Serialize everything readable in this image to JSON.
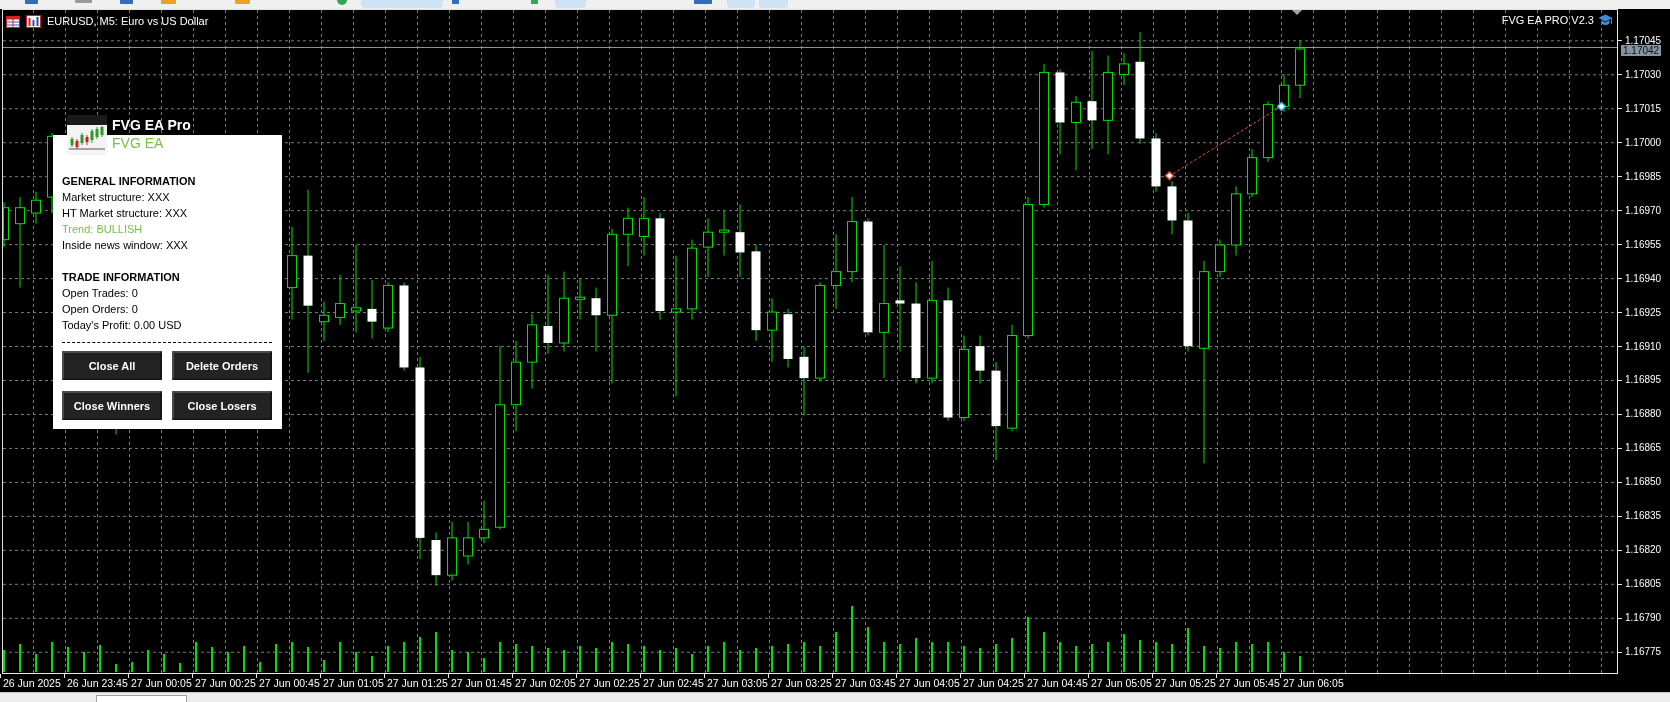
{
  "chart": {
    "title": "EURUSD, M5: Euro vs US Dollar",
    "indicator_label": "FVG EA PRO V2.3",
    "current_price": "1.17042",
    "price_axis": [
      "1.17045",
      "1.17030",
      "1.17015",
      "1.17000",
      "1.16985",
      "1.16970",
      "1.16955",
      "1.16940",
      "1.16925",
      "1.16910",
      "1.16895",
      "1.16880",
      "1.16865",
      "1.16850",
      "1.16835",
      "1.16820",
      "1.16805",
      "1.16790",
      "1.16775"
    ],
    "time_axis": [
      "26 Jun 2025",
      "26 Jun 23:45",
      "27 Jun 00:05",
      "27 Jun 00:25",
      "27 Jun 00:45",
      "27 Jun 01:05",
      "27 Jun 01:25",
      "27 Jun 01:45",
      "27 Jun 02:05",
      "27 Jun 02:25",
      "27 Jun 02:45",
      "27 Jun 03:05",
      "27 Jun 03:25",
      "27 Jun 03:45",
      "27 Jun 04:05",
      "27 Jun 04:25",
      "27 Jun 04:45",
      "27 Jun 05:05",
      "27 Jun 05:25",
      "27 Jun 05:45",
      "27 Jun 06:05"
    ]
  },
  "panel": {
    "title": "FVG EA Pro",
    "subtitle": "FVG EA",
    "sections": [
      {
        "heading": "GENERAL INFORMATION",
        "lines": [
          {
            "text": "Market structure: XXX",
            "highlighted": false
          },
          {
            "text": "HT Market structure: XXX",
            "highlighted": false
          },
          {
            "text": "Trend: BULLISH",
            "highlighted": true
          },
          {
            "text": "Inside news window: XXX",
            "highlighted": false
          }
        ]
      },
      {
        "heading": "TRADE INFORMATION",
        "lines": [
          {
            "text": "Open Trades: 0",
            "highlighted": false
          },
          {
            "text": "Open Orders: 0",
            "highlighted": false
          },
          {
            "text": "Today's Profit: 0.00 USD",
            "highlighted": false
          }
        ]
      }
    ],
    "buttons": [
      "Close All",
      "Delete Orders",
      "Close Winners",
      "Close Losers"
    ]
  }
}
